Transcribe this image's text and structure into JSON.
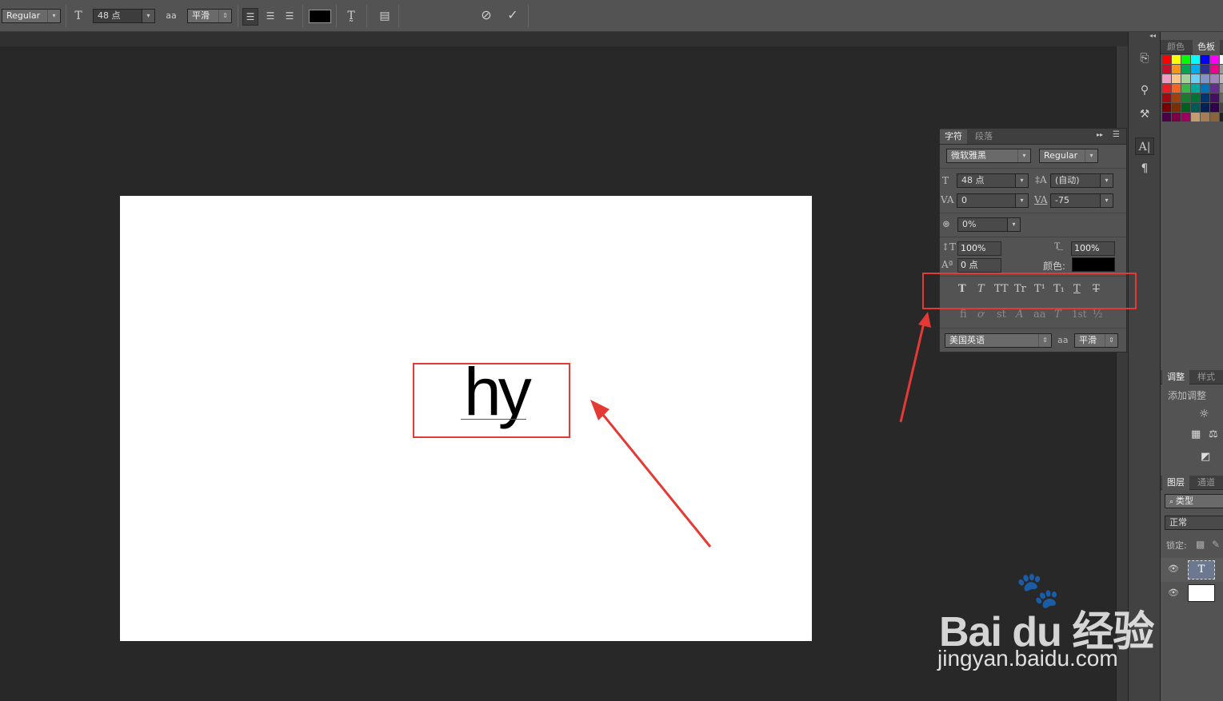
{
  "options_bar": {
    "font_style": "Regular",
    "font_size": "48 点",
    "antialias_icon": "aa",
    "antialias": "平滑",
    "text_color": "#000000",
    "cancel_icon": "cancel-icon",
    "commit_icon": "commit-icon"
  },
  "document": {
    "text": "hy"
  },
  "char_panel": {
    "tabs": [
      "字符",
      "段落"
    ],
    "font_family": "微软雅黑",
    "font_style": "Regular",
    "font_size": "48 点",
    "leading": "(自动)",
    "kerning": "0",
    "tracking": "-75",
    "tsume": "0%",
    "vertical_scale": "100%",
    "horizontal_scale": "100%",
    "baseline_shift": "0 点",
    "color_label": "颜色:",
    "color": "#000000",
    "style_buttons": [
      "T",
      "T",
      "TT",
      "Tr",
      "T¹",
      "T₁",
      "T",
      "T"
    ],
    "opentype_buttons": [
      "fi",
      "ơ",
      "st",
      "A",
      "aa",
      "T",
      "1st",
      "½"
    ],
    "language": "美国英语",
    "aa_icon": "aa",
    "antialias": "平滑"
  },
  "right_panels": {
    "color_tabs": [
      "颜色",
      "色板"
    ],
    "adjust_tabs": [
      "调整",
      "样式"
    ],
    "adjust_label": "添加调整",
    "layers_tabs": [
      "图层",
      "通道"
    ],
    "layer_filter": "类型",
    "blend_mode": "正常",
    "lock_label": "锁定:",
    "layer_text_thumb": "T"
  },
  "swatch_colors": [
    [
      "#ff0000",
      "#ffff00",
      "#00ff00",
      "#00ffff",
      "#0000ff",
      "#ff00ff",
      "#ffffff"
    ],
    [
      "#c8102e",
      "#f7941d",
      "#00a651",
      "#00aeef",
      "#2e3192",
      "#ec008c",
      "#999999"
    ],
    [
      "#f49ac1",
      "#fdc689",
      "#a3d39c",
      "#6dcff6",
      "#8393ca",
      "#a186be",
      "#bbbbbb"
    ],
    [
      "#ed1c24",
      "#f26522",
      "#39b54a",
      "#00a99d",
      "#0072bc",
      "#662d91",
      "#888888"
    ],
    [
      "#9e0b0f",
      "#a0410d",
      "#197b30",
      "#007236",
      "#003471",
      "#440e62",
      "#666666"
    ],
    [
      "#790000",
      "#7b2e00",
      "#005e20",
      "#005952",
      "#002157",
      "#32004b",
      "#444444"
    ],
    [
      "#4b0049",
      "#7b0046",
      "#9e005d",
      "#c69c6d",
      "#a67c52",
      "#8c6239",
      "#222222"
    ]
  ],
  "watermark": {
    "brand": "Bai du 经验",
    "url": "jingyan.baidu.com"
  }
}
